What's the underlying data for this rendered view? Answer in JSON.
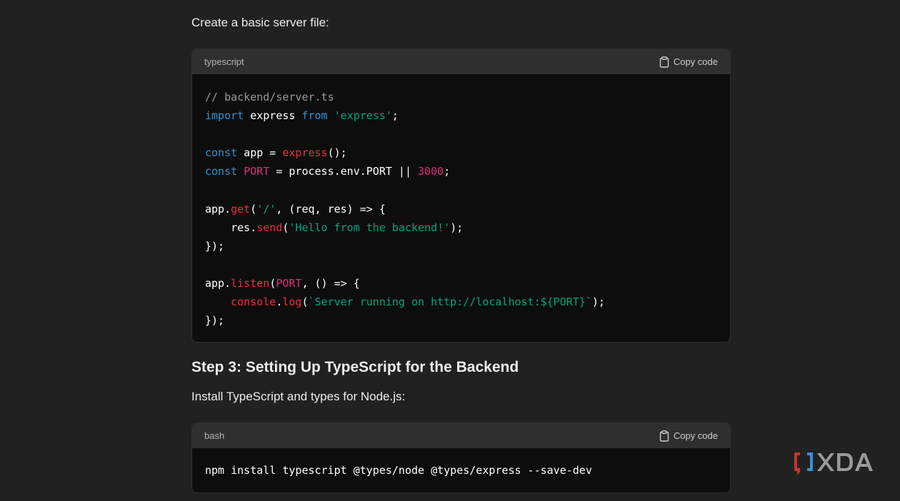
{
  "intro_text": "Create a basic server file:",
  "code_block_1": {
    "language": "typescript",
    "copy_label": "Copy code",
    "lines": [
      [
        {
          "t": "// backend/server.ts",
          "c": "comment"
        }
      ],
      [
        {
          "t": "import",
          "c": "keyword"
        },
        {
          "t": " express ",
          "c": "plain"
        },
        {
          "t": "from",
          "c": "keyword"
        },
        {
          "t": " ",
          "c": "plain"
        },
        {
          "t": "'express'",
          "c": "string"
        },
        {
          "t": ";",
          "c": "plain"
        }
      ],
      [],
      [
        {
          "t": "const",
          "c": "keyword"
        },
        {
          "t": " app = ",
          "c": "plain"
        },
        {
          "t": "express",
          "c": "func"
        },
        {
          "t": "();",
          "c": "plain"
        }
      ],
      [
        {
          "t": "const",
          "c": "keyword"
        },
        {
          "t": " ",
          "c": "plain"
        },
        {
          "t": "PORT",
          "c": "var"
        },
        {
          "t": " = process.env.PORT || ",
          "c": "plain"
        },
        {
          "t": "3000",
          "c": "var"
        },
        {
          "t": ";",
          "c": "plain"
        }
      ],
      [],
      [
        {
          "t": "app.",
          "c": "plain"
        },
        {
          "t": "get",
          "c": "func"
        },
        {
          "t": "(",
          "c": "plain"
        },
        {
          "t": "'/'",
          "c": "string"
        },
        {
          "t": ", (req, res) => {",
          "c": "plain"
        }
      ],
      [
        {
          "t": "    res.",
          "c": "plain"
        },
        {
          "t": "send",
          "c": "func"
        },
        {
          "t": "(",
          "c": "plain"
        },
        {
          "t": "'Hello from the backend!'",
          "c": "string"
        },
        {
          "t": ");",
          "c": "plain"
        }
      ],
      [
        {
          "t": "});",
          "c": "plain"
        }
      ],
      [],
      [
        {
          "t": "app.",
          "c": "plain"
        },
        {
          "t": "listen",
          "c": "func"
        },
        {
          "t": "(",
          "c": "plain"
        },
        {
          "t": "PORT",
          "c": "var"
        },
        {
          "t": ", () => {",
          "c": "plain"
        }
      ],
      [
        {
          "t": "    ",
          "c": "plain"
        },
        {
          "t": "console",
          "c": "func"
        },
        {
          "t": ".",
          "c": "plain"
        },
        {
          "t": "log",
          "c": "func"
        },
        {
          "t": "(",
          "c": "plain"
        },
        {
          "t": "`Server running on http://localhost:${PORT}`",
          "c": "string"
        },
        {
          "t": ");",
          "c": "plain"
        }
      ],
      [
        {
          "t": "});",
          "c": "plain"
        }
      ]
    ]
  },
  "step_heading": "Step 3: Setting Up TypeScript for the Backend",
  "install_text": "Install TypeScript and types for Node.js:",
  "code_block_2": {
    "language": "bash",
    "copy_label": "Copy code",
    "lines": [
      [
        {
          "t": "npm install typescript @types/node @types/express --save-dev",
          "c": "plain"
        }
      ]
    ]
  },
  "watermark": {
    "brand": "XDA",
    "colors": {
      "bracket_red": "#c0392b",
      "bracket_blue": "#3b8fd9",
      "text": "#9a9a9a"
    }
  }
}
